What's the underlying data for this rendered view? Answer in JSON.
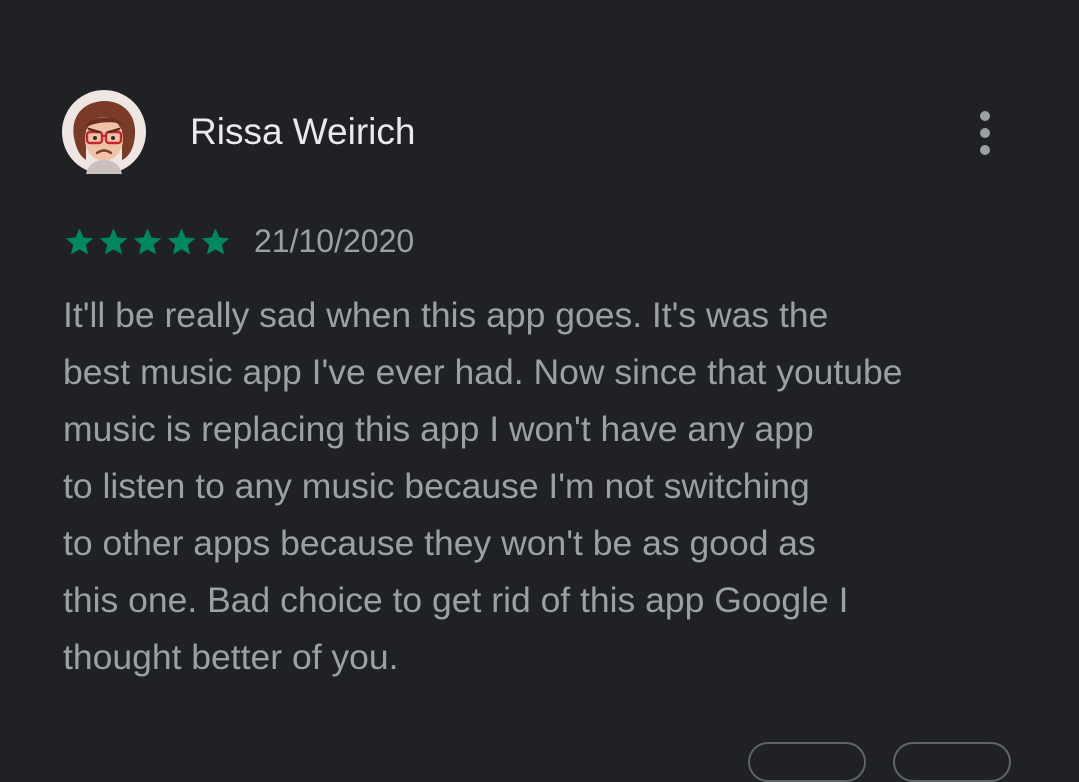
{
  "review": {
    "author": "Rissa Weirich",
    "avatar_icon": "bitmoji-avatar-icon",
    "menu_icon": "more-vert-icon",
    "rating": 5,
    "rating_max": 5,
    "star_icon": "star-icon",
    "star_color": "#01875f",
    "date": "21/10/2020",
    "text_lines": [
      "It'll be really sad when this app goes. It's was the",
      "best music app I've ever had. Now since that youtube",
      "music is replacing this app I won't have any app",
      "to listen to any music because I'm not switching",
      "to other apps because they won't be as good as",
      "this one. Bad choice to get rid of this app Google I",
      "thought better of you."
    ]
  },
  "colors": {
    "background": "#202124",
    "name_text": "#e8eaed",
    "secondary_text": "#9aa0a6",
    "chip_border": "#5f6368"
  }
}
